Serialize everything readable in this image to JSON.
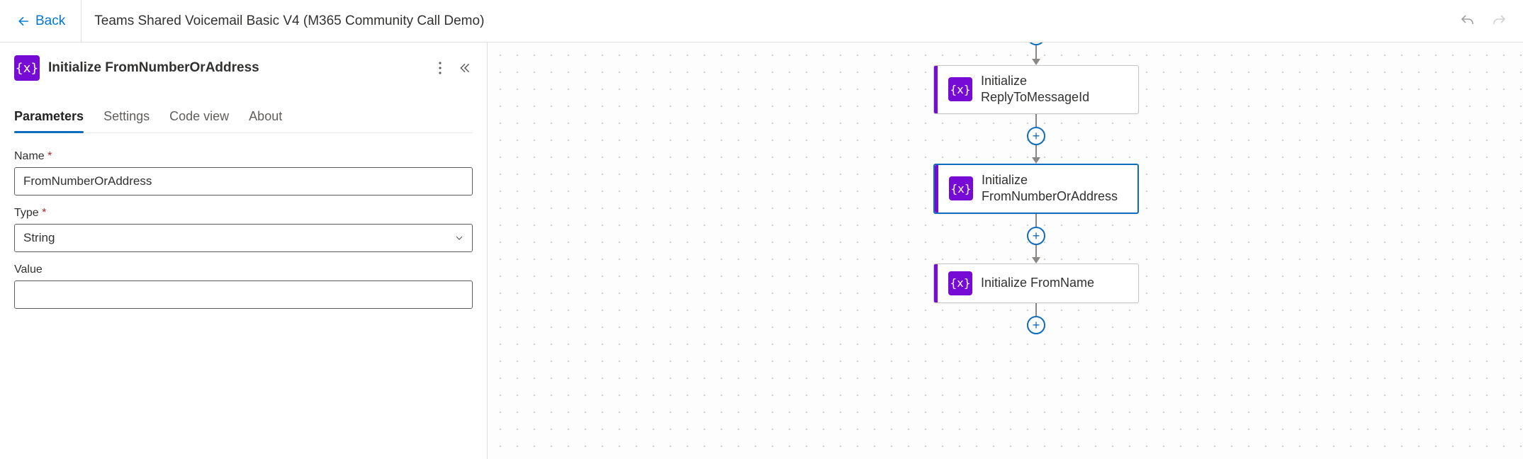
{
  "header": {
    "back_label": "Back",
    "title": "Teams Shared Voicemail Basic V4 (M365 Community Call Demo)"
  },
  "panel": {
    "icon_glyph": "{x}",
    "title": "Initialize FromNumberOrAddress",
    "tabs": [
      {
        "label": "Parameters",
        "active": true
      },
      {
        "label": "Settings",
        "active": false
      },
      {
        "label": "Code view",
        "active": false
      },
      {
        "label": "About",
        "active": false
      }
    ],
    "fields": {
      "name": {
        "label": "Name",
        "required": true,
        "value": "FromNumberOrAddress"
      },
      "type": {
        "label": "Type",
        "required": true,
        "value": "String"
      },
      "value": {
        "label": "Value",
        "required": false,
        "value": ""
      }
    }
  },
  "canvas": {
    "nodes": [
      {
        "icon_glyph": "{x}",
        "label": "Initialize ReplyToMessageId",
        "selected": false
      },
      {
        "icon_glyph": "{x}",
        "label": "Initialize FromNumberOrAddress",
        "selected": true
      },
      {
        "icon_glyph": "{x}",
        "label": "Initialize FromName",
        "selected": false
      }
    ]
  },
  "colors": {
    "variable_node": "#770bd6",
    "accent": "#0f6cbd"
  }
}
